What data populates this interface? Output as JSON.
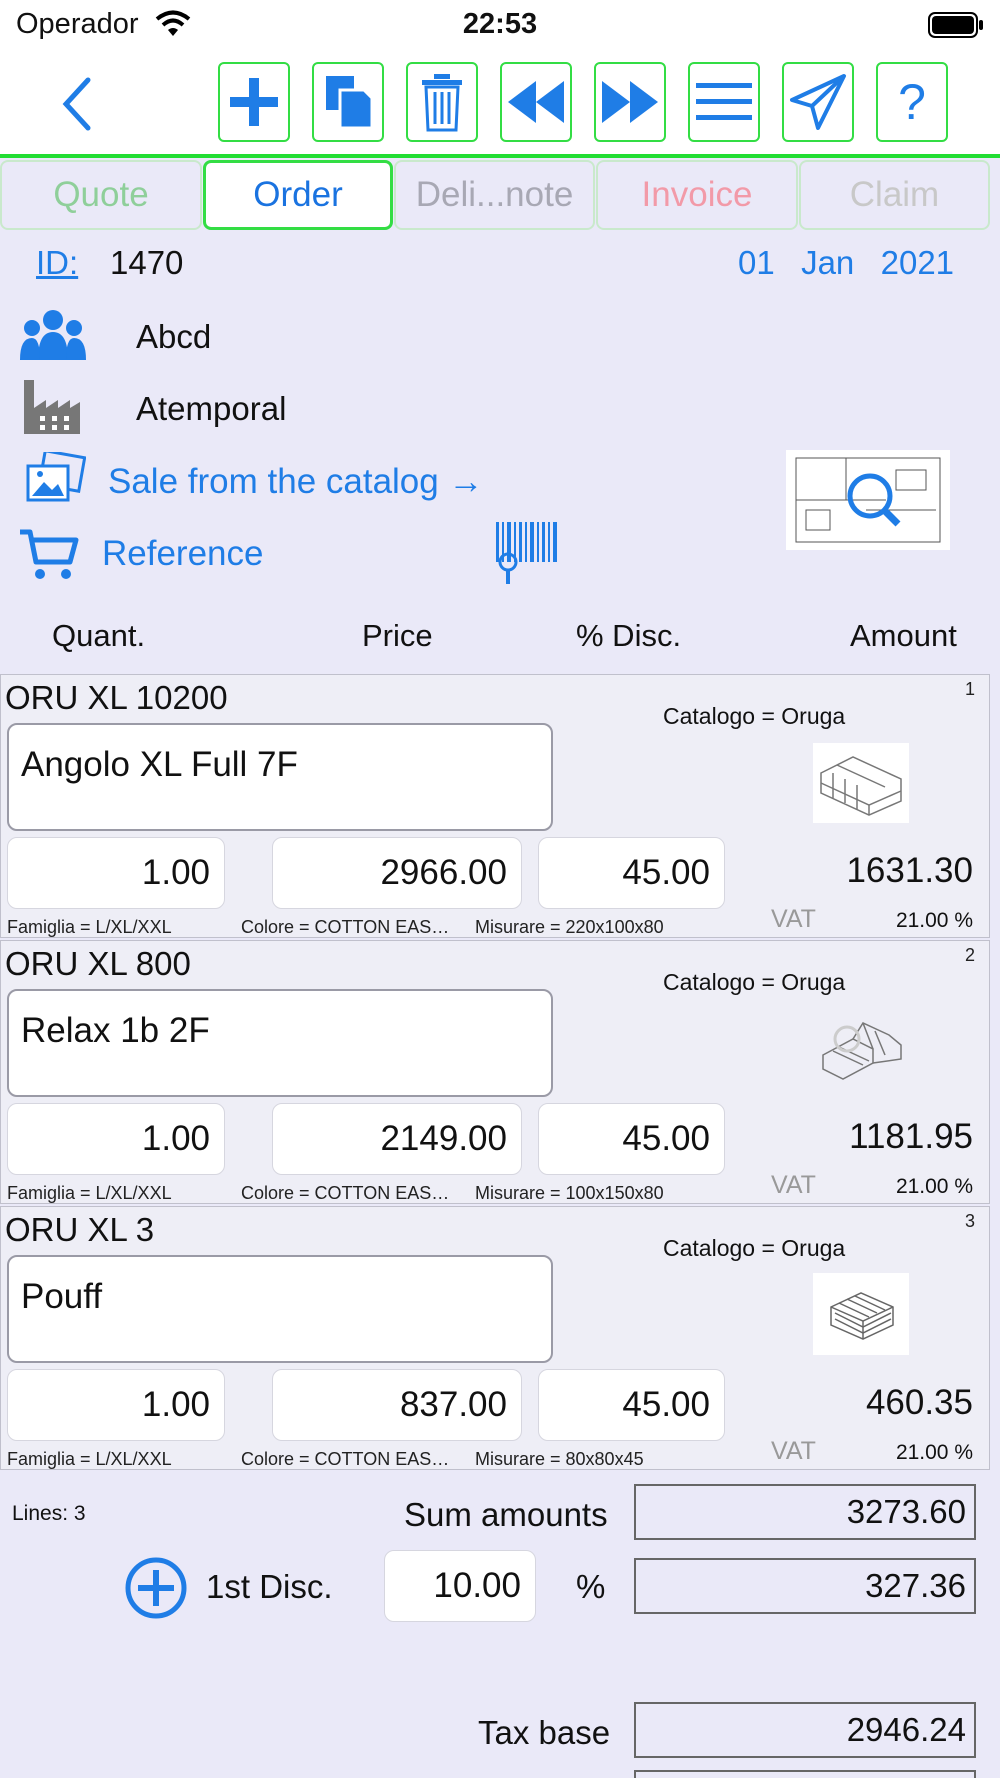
{
  "status": {
    "carrier": "Operador",
    "time": "22:53"
  },
  "toolbar": {
    "buttons": [
      "add",
      "copy",
      "delete",
      "previous",
      "next",
      "menu",
      "send",
      "help"
    ],
    "help_label": "?"
  },
  "tabs": [
    {
      "label": "Quote",
      "color": "#8fcf9a"
    },
    {
      "label": "Order",
      "color": "#1a73e0"
    },
    {
      "label": "Deli...note",
      "color": "#a8a8b4"
    },
    {
      "label": "Invoice",
      "color": "#f29aa8"
    },
    {
      "label": "Claim",
      "color": "#c8c8c8"
    }
  ],
  "header": {
    "id_label": "ID:",
    "id_value": "1470",
    "date_day": "01",
    "date_month": "Jan",
    "date_year": "2021",
    "customer": "Abcd",
    "supplier": "Atemporal",
    "catalog_link": "Sale from the catalog →",
    "reference_label": "Reference"
  },
  "columns": {
    "quant": "Quant.",
    "price": "Price",
    "disc": "% Disc.",
    "amount": "Amount"
  },
  "lines": [
    {
      "code": "ORU XL 10200",
      "number": "1",
      "catalog": "Catalogo = Oruga",
      "description": "Angolo XL Full 7F",
      "quantity": "1.00",
      "price": "2966.00",
      "discount": "45.00",
      "amount": "1631.30",
      "famiglia": "Famiglia = L/XL/XXL",
      "colore": "Colore = COTTON EAS…",
      "misurare": "Misurare = 220x100x80",
      "vat_label": "VAT",
      "vat_rate": "21.00 %"
    },
    {
      "code": "ORU XL 800",
      "number": "2",
      "catalog": "Catalogo = Oruga",
      "description": "Relax 1b 2F",
      "quantity": "1.00",
      "price": "2149.00",
      "discount": "45.00",
      "amount": "1181.95",
      "famiglia": "Famiglia = L/XL/XXL",
      "colore": "Colore = COTTON EAS…",
      "misurare": "Misurare = 100x150x80",
      "vat_label": "VAT",
      "vat_rate": "21.00 %"
    },
    {
      "code": "ORU XL 3",
      "number": "3",
      "catalog": "Catalogo = Oruga",
      "description": "Pouff",
      "quantity": "1.00",
      "price": "837.00",
      "discount": "45.00",
      "amount": "460.35",
      "famiglia": "Famiglia = L/XL/XXL",
      "colore": "Colore = COTTON EAS…",
      "misurare": "Misurare = 80x80x45",
      "vat_label": "VAT",
      "vat_rate": "21.00 %"
    }
  ],
  "totals": {
    "lines_count": "Lines: 3",
    "sum_label": "Sum amounts",
    "sum_value": "3273.60",
    "disc_label": "1st Disc.",
    "disc_pct": "10.00",
    "pct_sign": "%",
    "disc_value": "327.36",
    "tax_base_label": "Tax base",
    "tax_base_value": "2946.24"
  }
}
